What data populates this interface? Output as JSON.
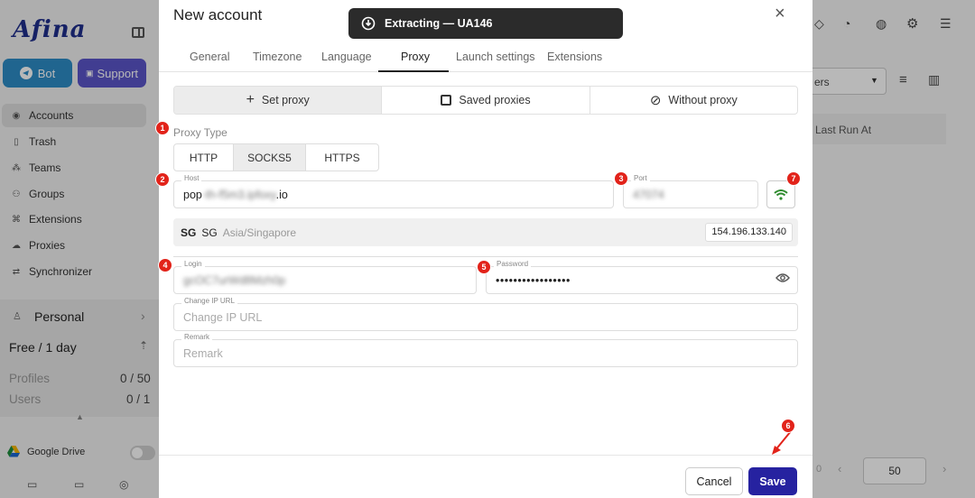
{
  "sidebar": {
    "logo": "Afina",
    "bot_label": "Bot",
    "support_label": "Support",
    "nav": [
      {
        "label": "Accounts",
        "icon": "accounts-icon"
      },
      {
        "label": "Trash",
        "icon": "trash-icon"
      },
      {
        "label": "Teams",
        "icon": "teams-icon"
      },
      {
        "label": "Groups",
        "icon": "groups-icon"
      },
      {
        "label": "Extensions",
        "icon": "extensions-icon"
      },
      {
        "label": "Proxies",
        "icon": "proxies-icon"
      },
      {
        "label": "Synchronizer",
        "icon": "synchronizer-icon"
      }
    ],
    "plan": {
      "name": "Personal",
      "period": "Free / 1 day",
      "profiles_label": "Profiles",
      "profiles_value": "0 / 50",
      "users_label": "Users",
      "users_value": "0 / 1"
    },
    "gdrive_label": "Google Drive"
  },
  "background": {
    "dropdown_partial": "ers",
    "column_partial": "Last Run At",
    "pager_count": "50",
    "pager_zero": "0"
  },
  "toast": {
    "text": "Extracting — UA146"
  },
  "modal": {
    "title": "New account",
    "tabs": [
      "General",
      "Timezone",
      "Language",
      "Proxy",
      "Launch settings",
      "Extensions"
    ],
    "active_tab": "Proxy",
    "proxy_modes": [
      "Set proxy",
      "Saved proxies",
      "Without proxy"
    ],
    "proxy_type_label": "Proxy Type",
    "proxy_types": [
      "HTTP",
      "SOCKS5",
      "HTTPS"
    ],
    "active_proxy_type": "SOCKS5",
    "host": {
      "label": "Host",
      "value_prefix": "pop",
      "value_blurred": "-th-f5m3.ipfoxy",
      "value_suffix": ".io"
    },
    "port": {
      "label": "Port",
      "value_blurred": "47074"
    },
    "geo": {
      "country_code": "SG",
      "country": "SG",
      "timezone": "Asia/Singapore",
      "ip": "154.196.133.140"
    },
    "login": {
      "label": "Login",
      "value_blurred": "gcOC7urWd8Mzh0p"
    },
    "password": {
      "label": "Password",
      "value": "•••••••••••••••••"
    },
    "change_ip": {
      "label": "Change IP URL",
      "placeholder": "Change IP URL"
    },
    "remark": {
      "label": "Remark",
      "placeholder": "Remark"
    },
    "cancel_label": "Cancel",
    "save_label": "Save"
  },
  "annotations": [
    "1",
    "2",
    "3",
    "4",
    "5",
    "6",
    "7"
  ],
  "colors": {
    "accent": "#2622a0",
    "badge": "#e2231a",
    "wifi": "#2e8b2e",
    "bot": "#2d8cc6",
    "support": "#5b55c9"
  }
}
